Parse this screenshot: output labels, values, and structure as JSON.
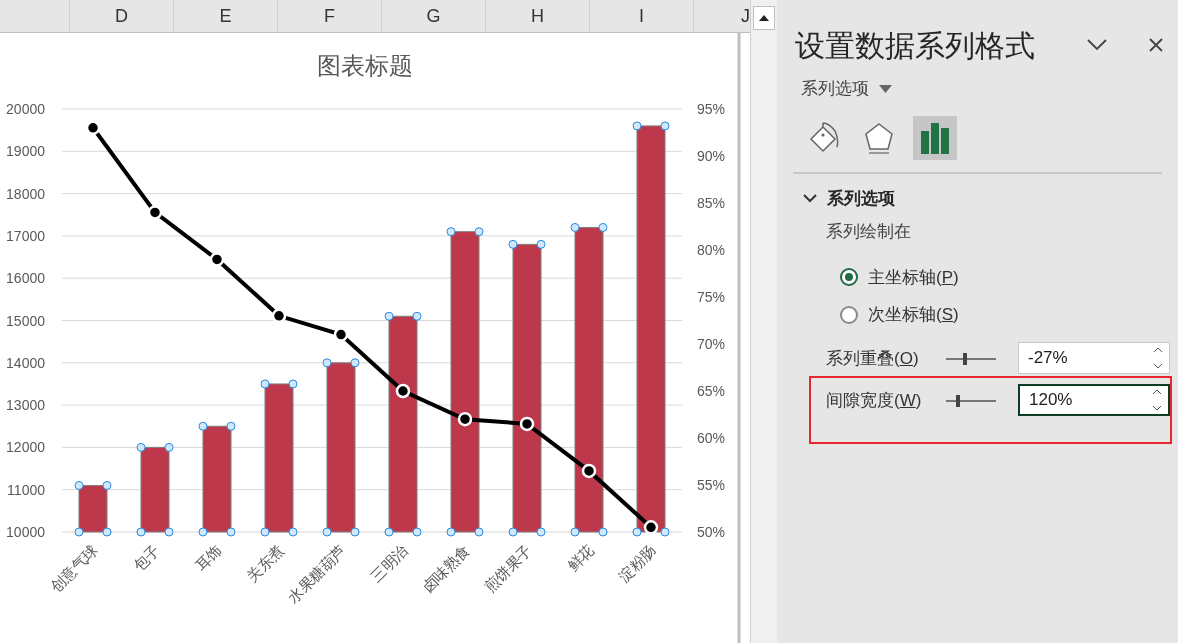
{
  "sheet": {
    "columns": [
      "D",
      "E",
      "F",
      "G",
      "H",
      "I",
      "J"
    ]
  },
  "chart": {
    "series_selected": [
      true,
      false
    ],
    "chart_data": {
      "type": "bar",
      "grid": true,
      "y2lim": [
        0.5,
        0.95
      ],
      "title": "图表标题",
      "categories": [
        "创意气球",
        "包子",
        "耳饰",
        "关东煮",
        "水果糖葫芦",
        "三明治",
        "卤味熟食",
        "煎饼果子",
        "鲜花",
        "淀粉肠"
      ],
      "series": [
        {
          "color": "#be384b",
          "values": [
            11100,
            12000,
            12500,
            13500,
            14000,
            15100,
            17100,
            16800,
            17200,
            19600
          ]
        },
        {
          "type": "line",
          "axis": "y2",
          "marker": "o",
          "color": "#000000",
          "values": [
            0.93,
            0.84,
            0.79,
            0.73,
            0.71,
            0.65,
            0.62,
            0.615,
            0.565,
            0.505
          ]
        }
      ],
      "ylim": [
        10000,
        20000
      ],
      "yticks": [
        10000,
        11000,
        12000,
        13000,
        14000,
        15000,
        16000,
        17000,
        18000,
        19000,
        20000
      ],
      "y2ticks": [
        {
          "value": 0.5,
          "label": "50%"
        },
        {
          "value": 0.55,
          "label": "55%"
        },
        {
          "value": 0.6,
          "label": "60%"
        },
        {
          "value": 0.65,
          "label": "65%"
        },
        {
          "value": 0.7,
          "label": "70%"
        },
        {
          "value": 0.75,
          "label": "75%"
        },
        {
          "value": 0.8,
          "label": "80%"
        },
        {
          "value": 0.85,
          "label": "85%"
        },
        {
          "value": 0.9,
          "label": "90%"
        },
        {
          "value": 0.95,
          "label": "95%"
        }
      ]
    }
  },
  "pane": {
    "title": "设置数据系列格式",
    "dropdown": "系列选项",
    "tabs": [
      {
        "kind": "fill",
        "selected": false
      },
      {
        "kind": "effects",
        "selected": false
      },
      {
        "kind": "options",
        "selected": true
      }
    ],
    "section": {
      "title": "系列选项",
      "expanded": true,
      "label": "系列绘制在",
      "radios": [
        {
          "label": "主坐标轴(P)",
          "selected": true
        },
        {
          "label": "次坐标轴(S)",
          "selected": false
        }
      ],
      "spinners": [
        {
          "label": "系列重叠(O)",
          "level": 0.37,
          "value": "-27%",
          "focused": false,
          "highlighted": false
        },
        {
          "label": "间隙宽度(W)",
          "level": 0.22,
          "value": "120%",
          "focused": true,
          "highlighted": true
        }
      ]
    }
  }
}
